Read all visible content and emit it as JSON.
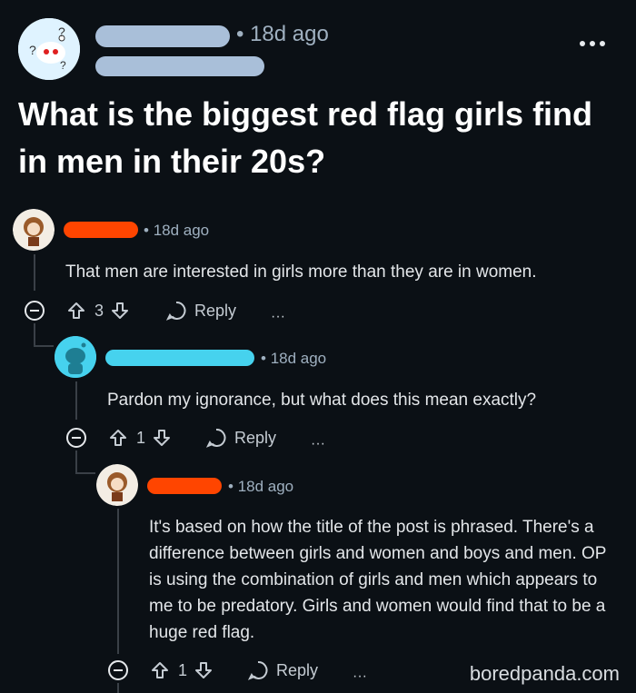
{
  "post": {
    "time": "18d ago",
    "title": "What is the biggest red flag girls find in men in their 20s?"
  },
  "comments": [
    {
      "time": "18d ago",
      "text": "That men are interested in girls more than they are in women.",
      "votes": "3",
      "reply_label": "Reply",
      "name_color": "#ff4500"
    },
    {
      "time": "18d ago",
      "text": "Pardon my ignorance, but what does this mean exactly?",
      "votes": "1",
      "reply_label": "Reply",
      "name_color": "#46d2ee"
    },
    {
      "time": "18d ago",
      "text": "It's based on how the title of the post is phrased. There's a difference between girls and women and boys and men. OP is using the combination of girls and men which appears to me to be predatory. Girls and women would find that to be a huge red flag.",
      "votes": "1",
      "reply_label": "Reply",
      "name_color": "#ff4500"
    }
  ],
  "watermark": "boredpanda.com",
  "colors": {
    "background": "#0b1015",
    "username_blur": "#a9bfd9"
  },
  "icons": [
    "upvote-icon",
    "downvote-icon",
    "reply-bubble-icon",
    "collapse-icon",
    "more-icon"
  ]
}
